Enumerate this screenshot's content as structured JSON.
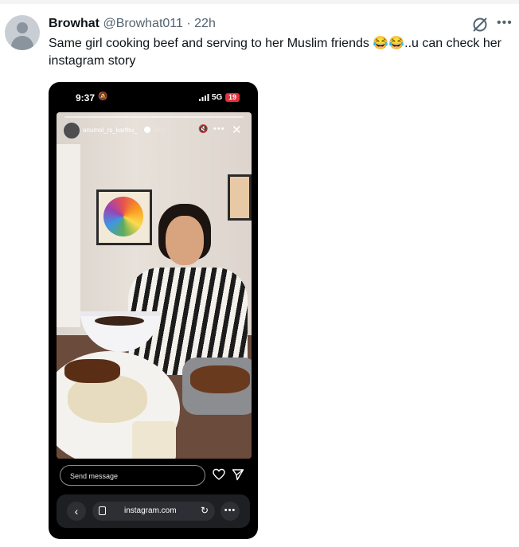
{
  "tweet": {
    "author_name": "Browhat",
    "author_handle": "@Browhat011",
    "separator": "·",
    "time": "22h",
    "text": "Same girl cooking beef and serving to her Muslim friends 😂😂..u can check her instagram story",
    "more_icon": "more-horizontal-icon",
    "grok_icon": "grok-icon"
  },
  "phone": {
    "status": {
      "time": "9:37",
      "network": "5G",
      "battery": "19"
    },
    "story": {
      "username": "anumol_rs_karthu_",
      "time": "18 h",
      "reply_placeholder": "Send message"
    },
    "browser": {
      "url": "instagram.com"
    }
  }
}
